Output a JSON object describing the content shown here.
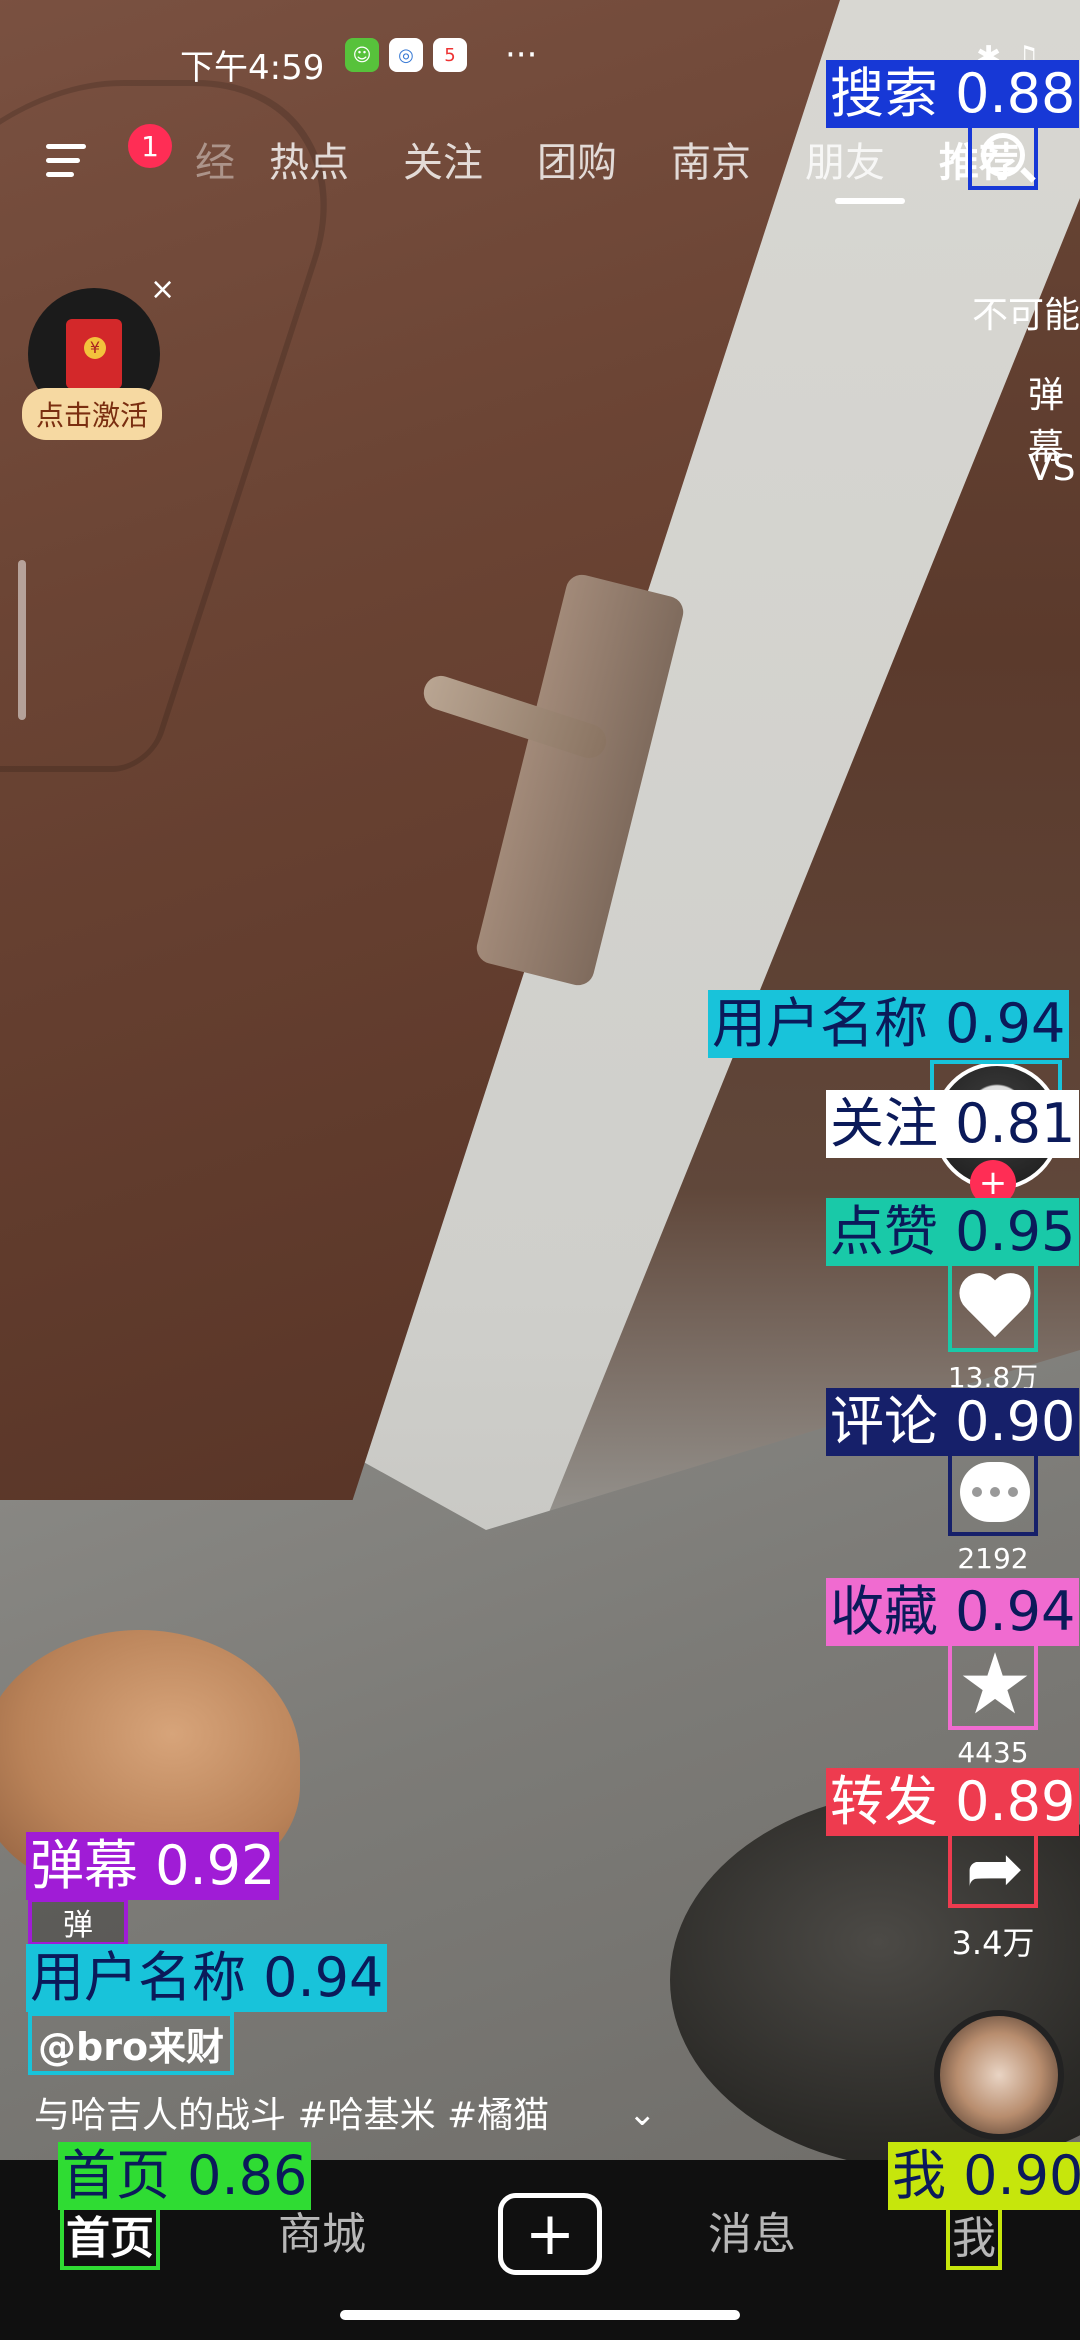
{
  "status_bar": {
    "time": "下午4:59",
    "more": "···"
  },
  "top_nav": {
    "badge_count": "1",
    "partial_tab": "经",
    "tabs": [
      "热点",
      "关注",
      "团购",
      "南京",
      "朋友",
      "推荐"
    ],
    "active_tab": "推荐"
  },
  "red_packet": {
    "label": "点击激活",
    "close": "×"
  },
  "danmaku_edge": [
    "不可能",
    "弹幕",
    "VS"
  ],
  "right_rail": {
    "like_count": "13.8万",
    "comment_count": "2192",
    "favorite_count": "4435",
    "share_count": "3.4万",
    "follow_symbol": "+"
  },
  "post": {
    "danmaku_toggle": "弹",
    "username": "@bro来财",
    "description": "与哈吉人的战斗 #哈基米 #橘猫",
    "expand_symbol": "⌄"
  },
  "bottom_nav": {
    "items": [
      "首页",
      "商城",
      "消息",
      "我"
    ],
    "active": "首页",
    "plus": "+"
  },
  "detections": [
    {
      "label": "搜索 0.88",
      "color": "#1738d6",
      "text_color": "#ffffff"
    },
    {
      "label": "用户名称 0.94",
      "color": "#18c3da",
      "text_color": "#0b1a5a"
    },
    {
      "label": "关注 0.81",
      "color": "#ffffff",
      "text_color": "#0b1a5a"
    },
    {
      "label": "点赞 0.95",
      "color": "#19c9a8",
      "text_color": "#0b1a5a"
    },
    {
      "label": "评论 0.90",
      "color": "#16206a",
      "text_color": "#ffffff"
    },
    {
      "label": "收藏 0.94",
      "color": "#f06bd0",
      "text_color": "#0b1a5a"
    },
    {
      "label": "转发 0.89",
      "color": "#ee3b4f",
      "text_color": "#ffffff"
    },
    {
      "label": "弹幕 0.92",
      "color": "#a01cd6",
      "text_color": "#ffffff"
    },
    {
      "label": "用户名称 0.94",
      "color": "#18c3da",
      "text_color": "#0b1a5a"
    },
    {
      "label": "首页 0.86",
      "color": "#2fdc33",
      "text_color": "#0b1a5a"
    },
    {
      "label": "我 0.90",
      "color": "#c6e60c",
      "text_color": "#0b1a5a"
    }
  ]
}
